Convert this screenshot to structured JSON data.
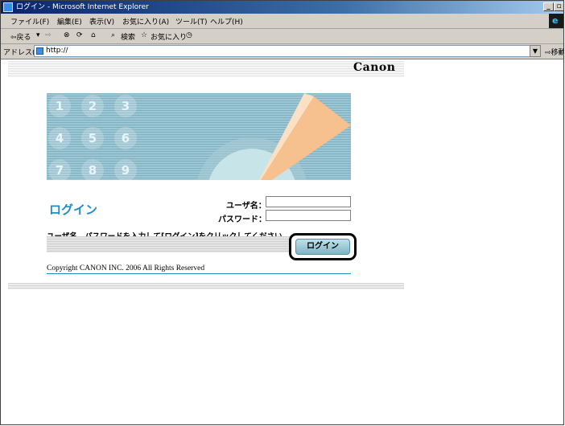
{
  "window": {
    "title": "ログイン - Microsoft Internet Explorer",
    "minimize": "_",
    "maximize": "8"
  },
  "menu": [
    {
      "label": "ファイル(F)"
    },
    {
      "label": "編集(E)"
    },
    {
      "label": "表示(V)"
    },
    {
      "label": "お気に入り(A)"
    },
    {
      "label": "ツール(T)"
    },
    {
      "label": "ヘルプ(H)"
    }
  ],
  "toolbar": {
    "back": "⇦戻る",
    "search": "検索",
    "favorites": "お気に入り"
  },
  "address": {
    "label": "アドレス(D)",
    "url": "http://",
    "go": "移動"
  },
  "page": {
    "logo": "Canon",
    "banner_numbers": [
      "1",
      "2",
      "3",
      "4",
      "5",
      "6",
      "7",
      "8",
      "9"
    ],
    "login_title": "ログイン",
    "username_label": "ユーザ名：",
    "password_label": "パスワード：",
    "username_value": "",
    "password_value": "",
    "instruction": "ユーザ名、パスワードを入力して[ログイン]をクリックしてください。",
    "login_button": "ログイン",
    "copyright": "Copyright CANON INC. 2006 All Rights Reserved"
  },
  "colors": {
    "accent": "#1c8ec4",
    "banner": "#8fbccb",
    "wedge": "#f6c08f"
  }
}
